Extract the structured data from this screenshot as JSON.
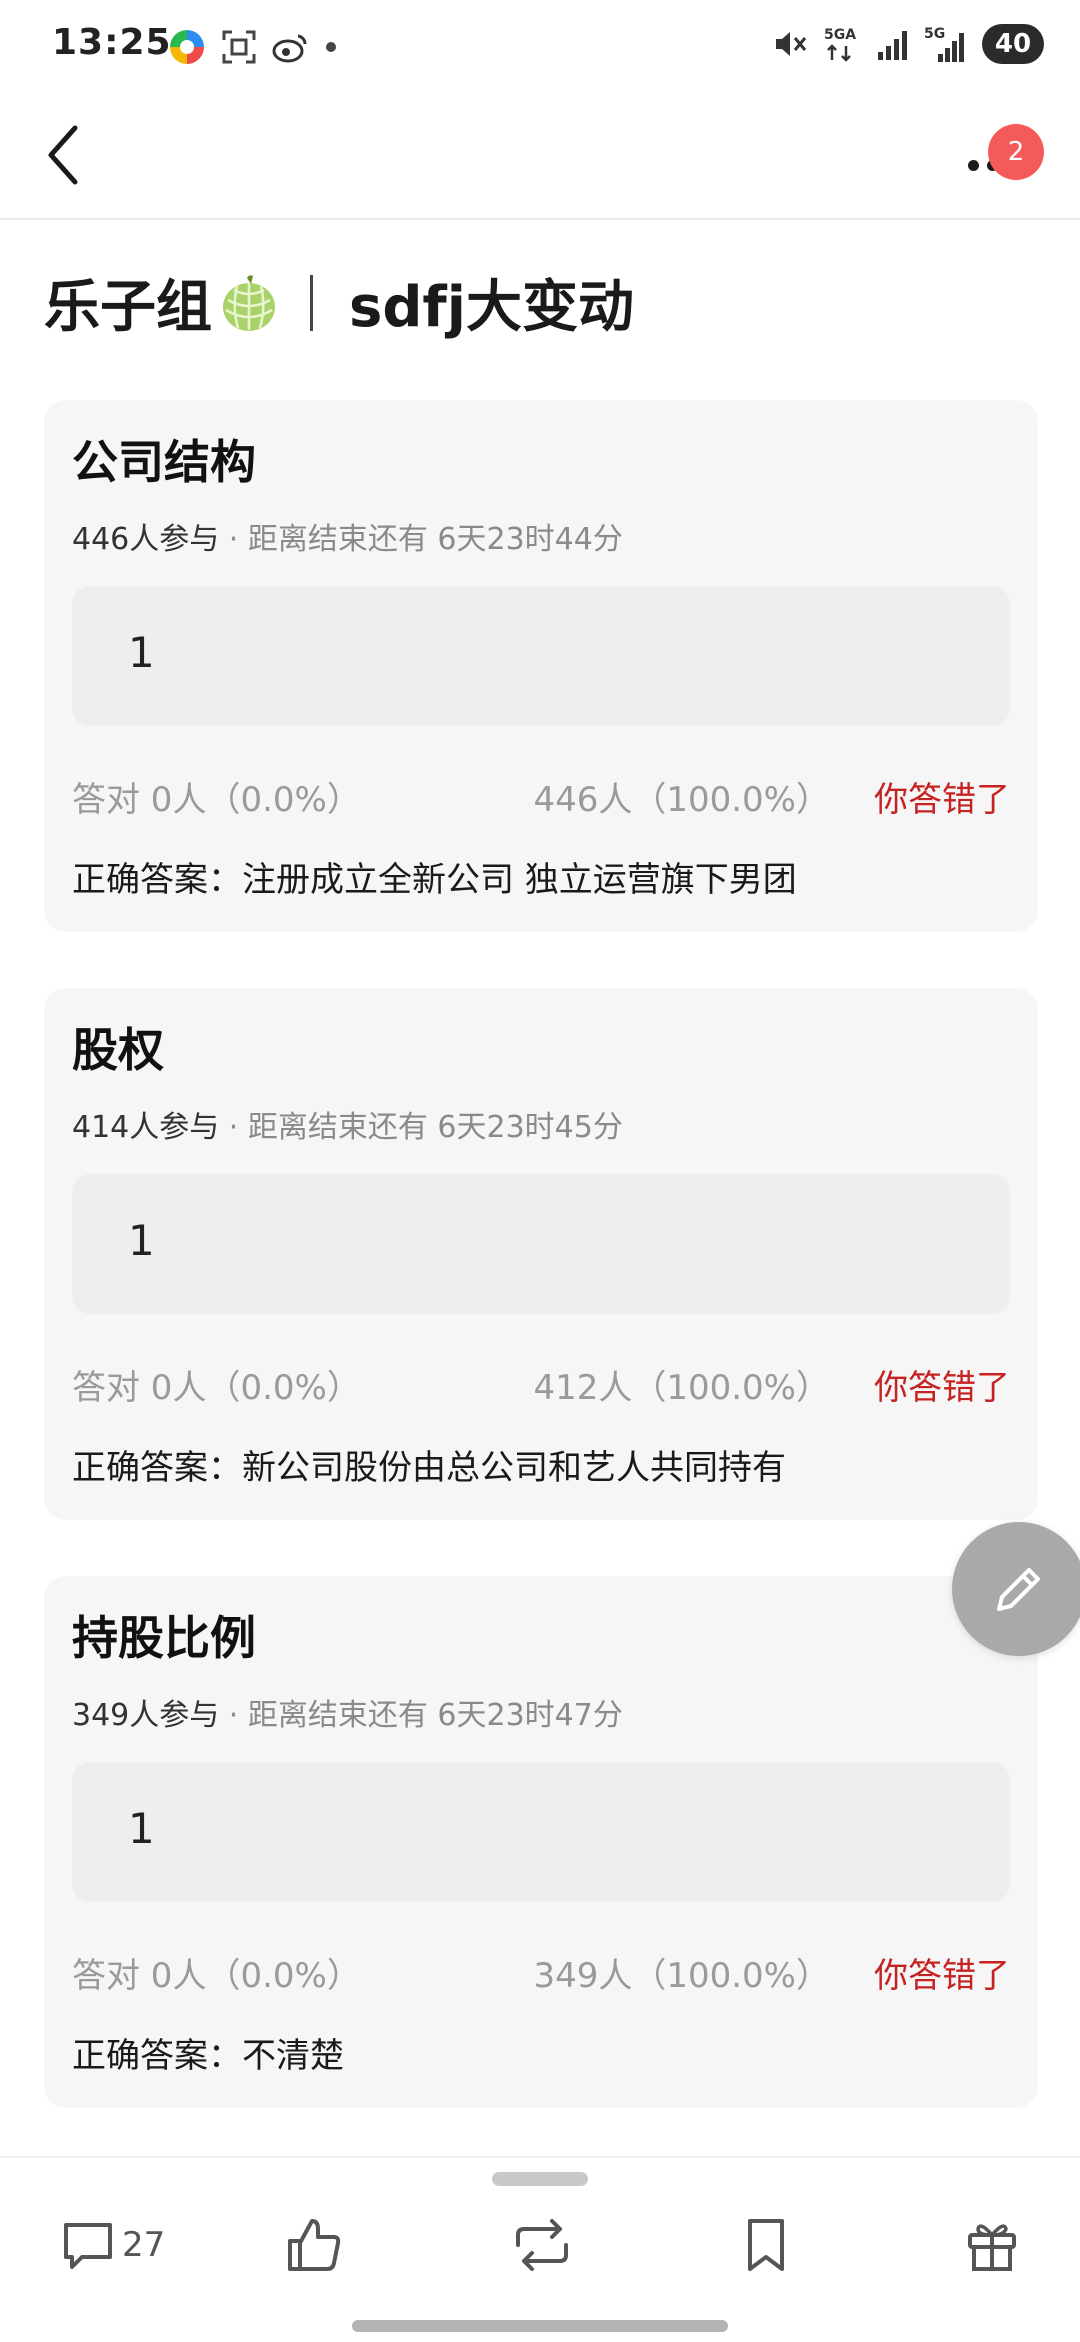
{
  "status_bar": {
    "time": "13:25",
    "network_1": "5GA",
    "network_2": "5G",
    "battery": "40"
  },
  "nav": {
    "badge_count": "2"
  },
  "page": {
    "title_left": "乐子组",
    "title_right": "sdfj大变动"
  },
  "quizzes": [
    {
      "title": "公司结构",
      "participants": "446人参与",
      "remaining": " · 距离结束还有 6天23时44分",
      "option": "1",
      "correct_stat": "答对  0人（0.0%）",
      "wrong_stat": "446人（100.0%）",
      "wrong_label": "你答错了",
      "answer": "正确答案：注册成立全新公司 独立运营旗下男团"
    },
    {
      "title": "股权",
      "participants": "414人参与",
      "remaining": " · 距离结束还有 6天23时45分",
      "option": "1",
      "correct_stat": "答对  0人（0.0%）",
      "wrong_stat": "412人（100.0%）",
      "wrong_label": "你答错了",
      "answer": "正确答案：新公司股份由总公司和艺人共同持有"
    },
    {
      "title": "持股比例",
      "participants": "349人参与",
      "remaining": " · 距离结束还有 6天23时47分",
      "option": "1",
      "correct_stat": "答对  0人（0.0%）",
      "wrong_stat": "349人（100.0%）",
      "wrong_label": "你答错了",
      "answer": "正确答案：不清楚"
    }
  ],
  "bottom_bar": {
    "comment_count": "27"
  },
  "colors": {
    "accent_red": "#c62222",
    "badge_red": "#f55a5a",
    "card_bg": "#f6f6f6",
    "option_bg": "#eeeeee"
  },
  "icons": {
    "back": "chevron-left-icon",
    "more": "more-dots-icon",
    "edit": "pencil-icon",
    "comment": "comment-icon",
    "like": "thumbs-up-icon",
    "repost": "repost-icon",
    "bookmark": "bookmark-icon",
    "gift": "gift-icon"
  }
}
